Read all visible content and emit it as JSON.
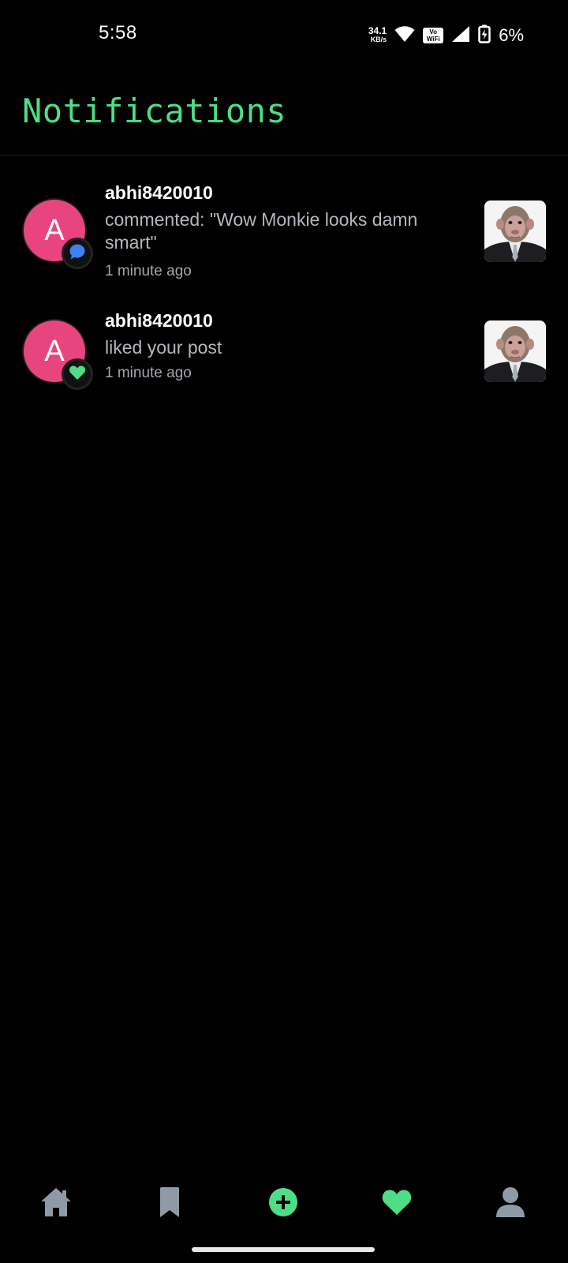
{
  "status_bar": {
    "time": "5:58",
    "net_speed_value": "34.1",
    "net_speed_unit": "KB/s",
    "vowifi_top": "Vo",
    "vowifi_bottom": "WiFi",
    "battery_percent": "6%"
  },
  "header": {
    "title": "Notifications"
  },
  "notifications": [
    {
      "avatar_letter": "A",
      "username": "abhi8420010",
      "message": "commented: \"Wow Monkie looks damn smart\"",
      "time": "1 minute ago",
      "badge_icon": "comment-icon",
      "badge_color": "#3b82f6"
    },
    {
      "avatar_letter": "A",
      "username": "abhi8420010",
      "message": "liked your post",
      "time": "1 minute ago",
      "badge_icon": "heart-icon",
      "badge_color": "#4ddf86"
    }
  ],
  "bottom_nav": [
    {
      "icon": "home-icon"
    },
    {
      "icon": "bookmark-icon"
    },
    {
      "icon": "add-post-icon"
    },
    {
      "icon": "heart-icon"
    },
    {
      "icon": "profile-icon"
    }
  ],
  "colors": {
    "accent": "#4ddf86",
    "avatar": "#e8457e",
    "background": "#000000",
    "nav_inactive": "#8e9aa6"
  }
}
